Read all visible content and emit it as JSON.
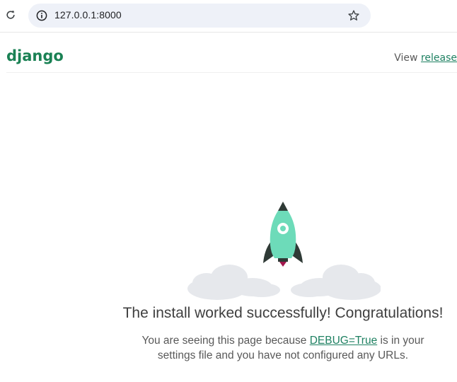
{
  "browser": {
    "url": "127.0.0.1:8000",
    "icons": [
      "reload-icon",
      "info-icon",
      "star-icon"
    ]
  },
  "header": {
    "logo": "django",
    "release_prefix": "View ",
    "release_link": "release "
  },
  "main": {
    "headline": "The install worked successfully! Congratulations!",
    "message_prefix": "You are seeing this page because ",
    "debug_link": "DEBUG=True",
    "message_middle": " is in your",
    "message_line2": "settings file and you have not configured any URLs.",
    "illustration": "rocket-launch"
  },
  "colors": {
    "brand": "#1a8154",
    "link": "#1f8162",
    "rocket_body": "#6ddbb9",
    "rocket_dark": "#2f3a36",
    "cloud": "#e6e8ec"
  }
}
